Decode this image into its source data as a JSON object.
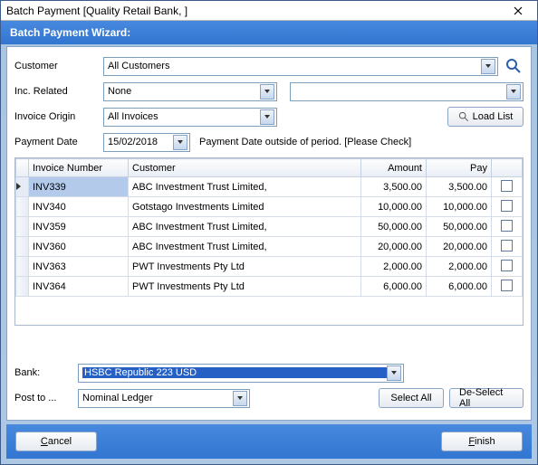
{
  "window": {
    "title": "Batch Payment [Quality Retail Bank, ]"
  },
  "wizard": {
    "heading": "Batch Payment Wizard:"
  },
  "fields": {
    "customer_label": "Customer",
    "customer_value": "All Customers",
    "inc_related_label": "Inc. Related",
    "inc_related_value": "None",
    "inc_related_extra": "",
    "invoice_origin_label": "Invoice Origin",
    "invoice_origin_value": "All Invoices",
    "load_list_label": "Load List",
    "payment_date_label": "Payment Date",
    "payment_date_value": "15/02/2018",
    "payment_date_warning": "Payment Date outside of period. [Please Check]"
  },
  "grid": {
    "cols": {
      "invoice": "Invoice Number",
      "customer": "Customer",
      "amount": "Amount",
      "pay": "Pay",
      "select": ""
    },
    "rows": [
      {
        "inv": "INV339",
        "cust": "ABC Investment Trust Limited,",
        "amount": "3,500.00",
        "pay": "3,500.00",
        "selected": true
      },
      {
        "inv": "INV340",
        "cust": "Gotstago Investments Limited",
        "amount": "10,000.00",
        "pay": "10,000.00",
        "selected": false
      },
      {
        "inv": "INV359",
        "cust": "ABC Investment Trust Limited,",
        "amount": "50,000.00",
        "pay": "50,000.00",
        "selected": false
      },
      {
        "inv": "INV360",
        "cust": "ABC Investment Trust Limited,",
        "amount": "20,000.00",
        "pay": "20,000.00",
        "selected": false
      },
      {
        "inv": "INV363",
        "cust": "PWT Investments Pty Ltd",
        "amount": "2,000.00",
        "pay": "2,000.00",
        "selected": false
      },
      {
        "inv": "INV364",
        "cust": "PWT Investments Pty Ltd",
        "amount": "6,000.00",
        "pay": "6,000.00",
        "selected": false
      }
    ]
  },
  "bank": {
    "label": "Bank:",
    "value": "HSBC Republic 223 USD"
  },
  "post": {
    "label": "Post to ...",
    "value": "Nominal Ledger"
  },
  "buttons": {
    "select_all": "Select All",
    "deselect_all": "De-Select All",
    "cancel_pre": "",
    "cancel_u": "C",
    "cancel_post": "ancel",
    "finish_pre": "",
    "finish_u": "F",
    "finish_post": "inish"
  }
}
